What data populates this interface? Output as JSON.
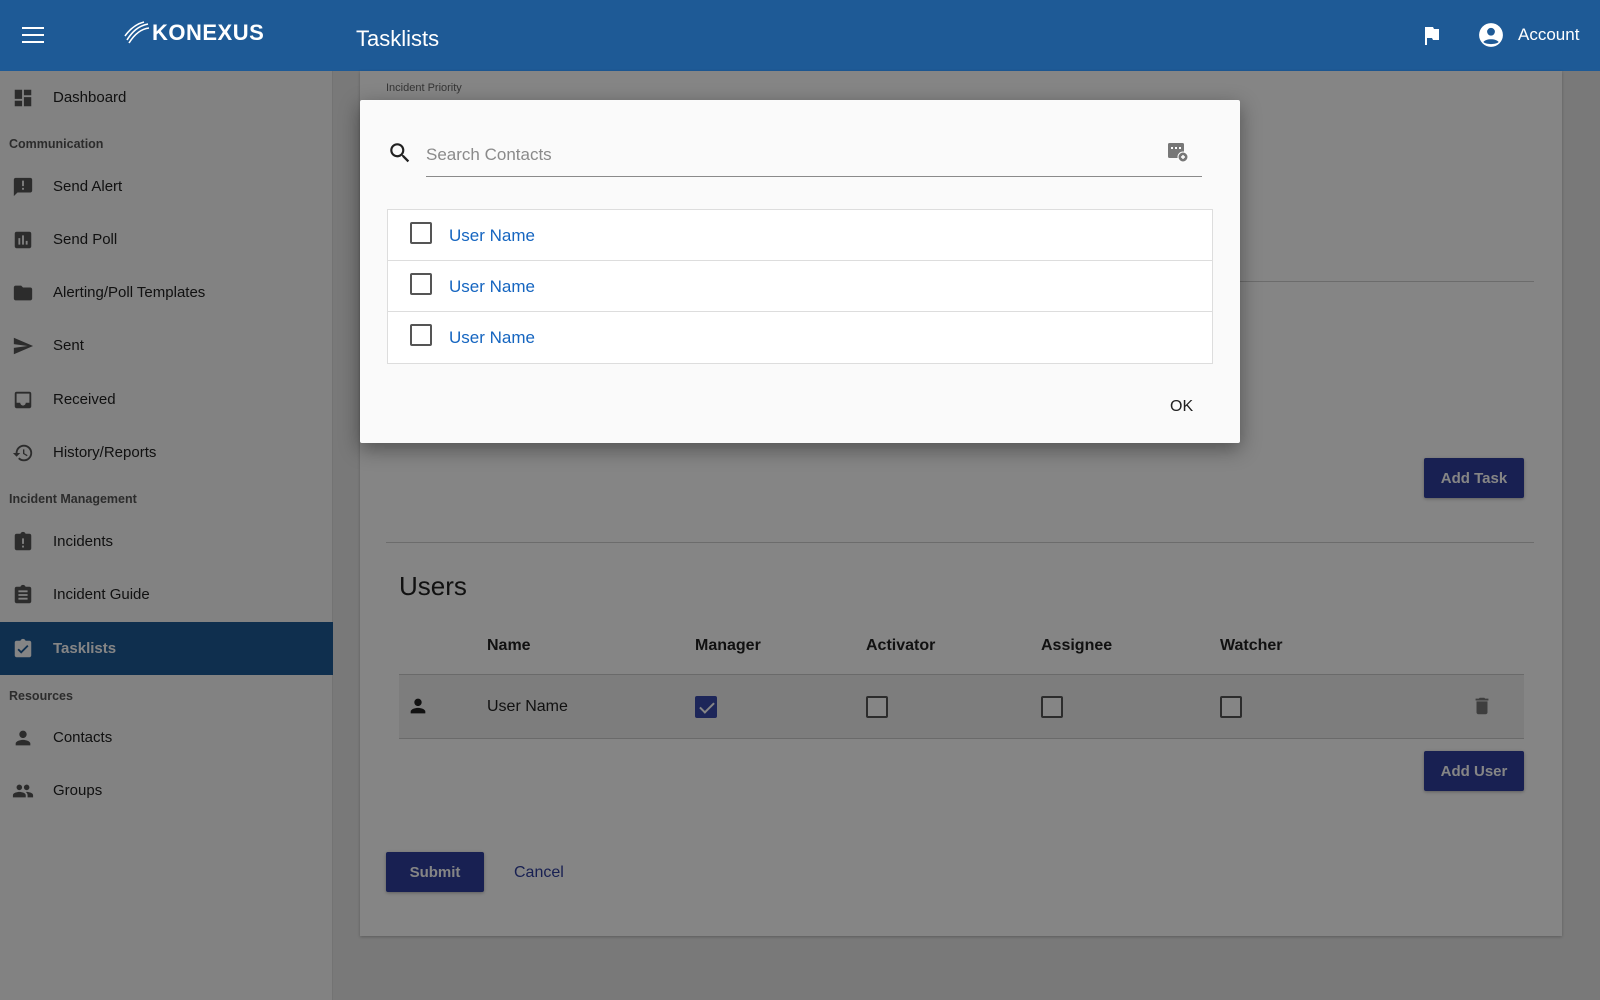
{
  "header": {
    "logo_text": "KONEXUS",
    "title": "Tasklists",
    "account_label": "Account",
    "icons": [
      "menu-icon",
      "flag-icon",
      "account-circle-icon"
    ]
  },
  "sidebar": {
    "dashboard": "Dashboard",
    "sections": {
      "communication": "Communication",
      "incident_management": "Incident Management",
      "resources": "Resources"
    },
    "items": {
      "send_alert": "Send Alert",
      "send_poll": "Send Poll",
      "templates": "Alerting/Poll Templates",
      "sent": "Sent",
      "received": "Received",
      "history": "History/Reports",
      "incidents": "Incidents",
      "incident_guide": "Incident Guide",
      "tasklists": "Tasklists",
      "contacts": "Contacts",
      "groups": "Groups"
    },
    "active_item": "Tasklists"
  },
  "form": {
    "incident_priority_label": "Incident Priority",
    "add_task_label": "Add Task",
    "users_title": "Users",
    "columns": {
      "name": "Name",
      "manager": "Manager",
      "activator": "Activator",
      "assignee": "Assignee",
      "watcher": "Watcher"
    },
    "users": [
      {
        "name": "User Name",
        "manager": true,
        "activator": false,
        "assignee": false,
        "watcher": false
      }
    ],
    "add_user_label": "Add User",
    "submit_label": "Submit",
    "cancel_label": "Cancel"
  },
  "dialog": {
    "search_placeholder": "Search Contacts",
    "search_value": "",
    "contacts": [
      {
        "name": "User Name",
        "checked": false
      },
      {
        "name": "User Name",
        "checked": false
      },
      {
        "name": "User Name",
        "checked": false
      }
    ],
    "ok_label": "OK"
  },
  "colors": {
    "brand": "#1e5a96",
    "primary_button": "#2f3f9e",
    "link": "#1565c0"
  }
}
